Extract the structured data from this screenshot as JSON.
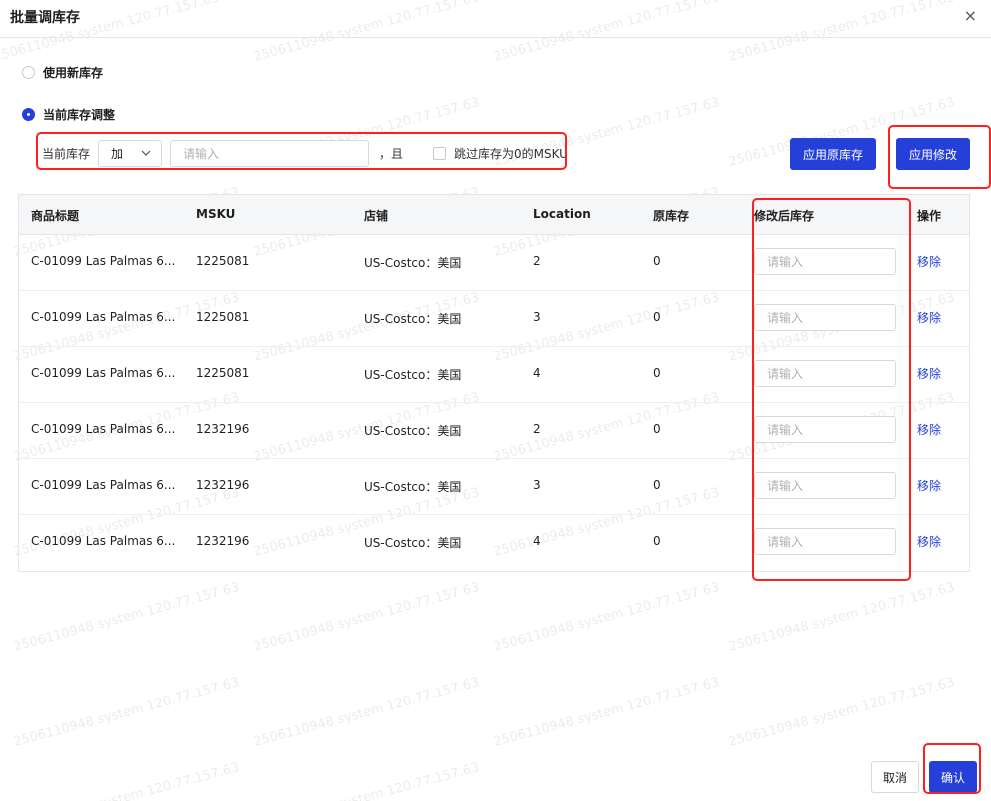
{
  "dialog": {
    "title": "批量调库存",
    "close_glyph": "×"
  },
  "options": {
    "use_new": {
      "label": "使用新库存",
      "selected": false
    },
    "adjust_current": {
      "label": "当前库存调整",
      "selected": true
    }
  },
  "adjust": {
    "label": "当前库存",
    "operator": "加",
    "amount_placeholder": "请输入",
    "conjunction": "，且",
    "skip_zero_label": "跳过库存为0的MSKU"
  },
  "buttons": {
    "apply_original": "应用原库存",
    "apply_modify": "应用修改",
    "cancel": "取消",
    "confirm": "确认"
  },
  "table": {
    "columns": [
      "商品标题",
      "MSKU",
      "店铺",
      "Location",
      "原库存",
      "修改后库存",
      "操作"
    ],
    "input_placeholder": "请输入",
    "remove_label": "移除",
    "rows": [
      {
        "title": "C-01099 Las Palmas 6...",
        "msku": "1225081",
        "shop": "US-Costco：美国",
        "location": "2",
        "original": "0"
      },
      {
        "title": "C-01099 Las Palmas 6...",
        "msku": "1225081",
        "shop": "US-Costco：美国",
        "location": "3",
        "original": "0"
      },
      {
        "title": "C-01099 Las Palmas 6...",
        "msku": "1225081",
        "shop": "US-Costco：美国",
        "location": "4",
        "original": "0"
      },
      {
        "title": "C-01099 Las Palmas 6...",
        "msku": "1232196",
        "shop": "US-Costco：美国",
        "location": "2",
        "original": "0"
      },
      {
        "title": "C-01099 Las Palmas 6...",
        "msku": "1232196",
        "shop": "US-Costco：美国",
        "location": "3",
        "original": "0"
      },
      {
        "title": "C-01099 Las Palmas 6...",
        "msku": "1232196",
        "shop": "US-Costco：美国",
        "location": "4",
        "original": "0"
      }
    ]
  },
  "watermark": "2506110948 system 120.77.157.63",
  "colors": {
    "primary": "#2440d8",
    "highlight": "#ff1f1f"
  }
}
